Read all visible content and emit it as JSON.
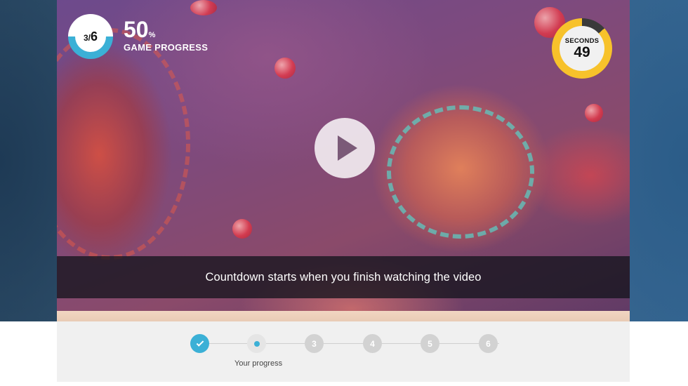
{
  "hud": {
    "level_current": "3",
    "level_separator": "/",
    "level_total": "6",
    "progress_value": "50",
    "progress_unit": "%",
    "progress_label": "GAME PROGRESS",
    "progress_fraction": 0.5
  },
  "timer": {
    "label": "SECONDS",
    "value": "49"
  },
  "video": {
    "caption": "Countdown starts when you finish watching the video",
    "play_icon": "play-icon"
  },
  "stepper": {
    "steps": [
      {
        "label": "",
        "state": "done",
        "icon": "check-icon"
      },
      {
        "label": "",
        "state": "current",
        "icon": "dot"
      },
      {
        "label": "3",
        "state": "pending"
      },
      {
        "label": "4",
        "state": "pending"
      },
      {
        "label": "5",
        "state": "pending"
      },
      {
        "label": "6",
        "state": "pending"
      }
    ],
    "caption": "Your progress"
  },
  "colors": {
    "accent": "#3bb0d6",
    "timer_ring": "#f7c22b",
    "step_pending": "#d2d2d2"
  }
}
